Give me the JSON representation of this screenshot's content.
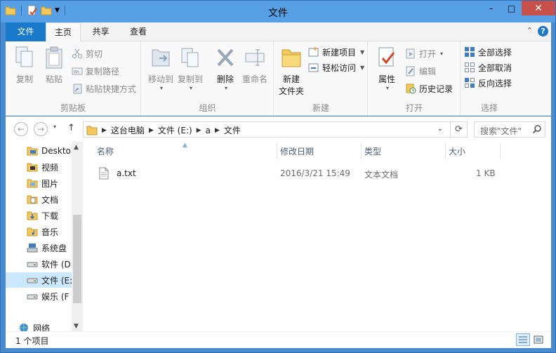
{
  "window": {
    "title": "文件"
  },
  "titlebar": {
    "minimize_glyph": "–",
    "maximize_glyph": "□",
    "close_glyph": "✕"
  },
  "tabs": {
    "file": "文件",
    "home": "主页",
    "share": "共享",
    "view": "查看",
    "collapse_glyph": "⌃",
    "help_glyph": "?"
  },
  "ribbon": {
    "clipboard": {
      "label": "剪贴板",
      "copy": "复制",
      "paste": "粘贴",
      "cut": "剪切",
      "copy_path": "复制路径",
      "paste_shortcut": "粘贴快捷方式"
    },
    "organize": {
      "label": "组织",
      "move_to": "移动到",
      "copy_to": "复制到",
      "delete": "删除",
      "rename": "重命名"
    },
    "new": {
      "label": "新建",
      "new_folder_line1": "新建",
      "new_folder_line2": "文件夹",
      "new_item": "新建项目",
      "easy_access": "轻松访问"
    },
    "open": {
      "label": "打开",
      "properties": "属性",
      "open": "打开",
      "edit": "编辑",
      "history": "历史记录"
    },
    "select": {
      "label": "选择",
      "select_all": "全部选择",
      "select_none": "全部取消",
      "invert": "反向选择"
    }
  },
  "address": {
    "crumbs": [
      "这台电脑",
      "文件 (E:)",
      "a",
      "文件"
    ],
    "search_placeholder": "搜索\"文件\""
  },
  "nav_pane": {
    "items": [
      {
        "label": "Desktop",
        "icon": "desktop-folder-icon"
      },
      {
        "label": "视频",
        "icon": "videos-folder-icon"
      },
      {
        "label": "图片",
        "icon": "pictures-folder-icon"
      },
      {
        "label": "文档",
        "icon": "documents-folder-icon"
      },
      {
        "label": "下载",
        "icon": "downloads-folder-icon"
      },
      {
        "label": "音乐",
        "icon": "music-folder-icon"
      },
      {
        "label": "系统盘",
        "icon": "system-drive-icon"
      },
      {
        "label": "软件 (D",
        "icon": "drive-icon"
      },
      {
        "label": "文件 (E:",
        "icon": "drive-icon"
      },
      {
        "label": "娱乐 (F",
        "icon": "drive-icon"
      },
      {
        "label": "网络",
        "icon": "network-icon"
      }
    ],
    "selected_index": 8
  },
  "file_list": {
    "columns": [
      "名称",
      "修改日期",
      "类型",
      "大小"
    ],
    "rows": [
      {
        "name": "a.txt",
        "modified": "2016/3/21 15:49",
        "type": "文本文档",
        "size": "1 KB"
      }
    ]
  },
  "status": {
    "item_count": "1 个项目"
  },
  "colors": {
    "accent": "#1979ca",
    "title_bar": "#57a0e6",
    "close": "#c7504b",
    "selection": "#cce8ff"
  }
}
